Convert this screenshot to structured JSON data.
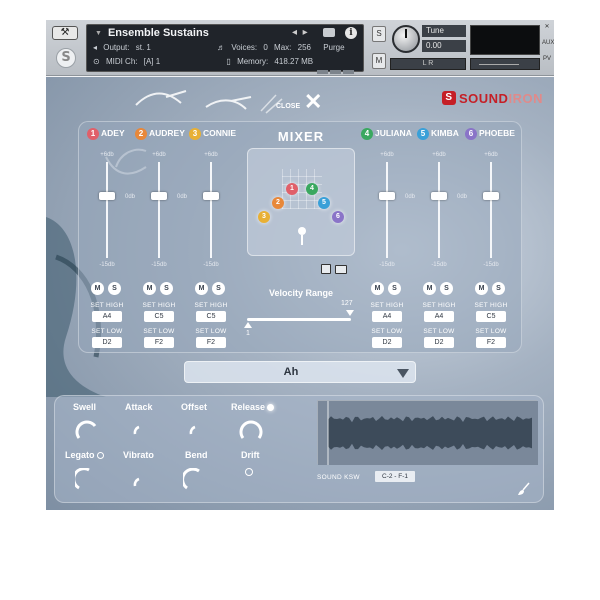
{
  "header": {
    "instrument_name": "Ensemble Sustains",
    "output_label": "Output:",
    "output_value": "st. 1",
    "voices_label": "Voices:",
    "voices_value": "0",
    "max_label": "Max:",
    "max_value": "256",
    "purge_label": "Purge",
    "midi_label": "MIDI Ch:",
    "midi_value": "[A]  1",
    "memory_label": "Memory:",
    "memory_value": "418.27 MB",
    "solo_label": "S",
    "mute_label": "M",
    "tune_label": "Tune",
    "tune_value": "0.00",
    "out_label": "L  R",
    "side_top": "AUX",
    "side_bottom": "PV"
  },
  "brand": {
    "s": "S",
    "name": "SOUND",
    "name2": "IRON"
  },
  "close": {
    "label": "CLOSE",
    "glyph": "✕"
  },
  "mixer": {
    "title": "MIXER",
    "singers": [
      {
        "num": "1",
        "name": "ADEY",
        "color": "#e0606a",
        "set_high": "A4",
        "set_low": "D2"
      },
      {
        "num": "2",
        "name": "AUDREY",
        "color": "#e8883a",
        "set_high": "C5",
        "set_low": "F2"
      },
      {
        "num": "3",
        "name": "CONNIE",
        "color": "#e8b035",
        "set_high": "C5",
        "set_low": "F2"
      },
      {
        "num": "4",
        "name": "JULIANA",
        "color": "#3aa860",
        "set_high": "A4",
        "set_low": "D2"
      },
      {
        "num": "5",
        "name": "KIMBA",
        "color": "#3aa0d8",
        "set_high": "A4",
        "set_low": "D2"
      },
      {
        "num": "6",
        "name": "PHOEBE",
        "color": "#8a74c8",
        "set_high": "C5",
        "set_low": "F2"
      }
    ],
    "fader_top": "+6db",
    "fader_mid": "0db",
    "fader_bot": "-15db",
    "mute": "M",
    "solo": "S",
    "set_high_label": "SET HIGH",
    "set_low_label": "SET LOW",
    "velocity_title": "Velocity Range",
    "velocity_min": "1",
    "velocity_max": "127"
  },
  "articulation": {
    "value": "Ah"
  },
  "controls": {
    "swell": "Swell",
    "attack": "Attack",
    "offset": "Offset",
    "release": "Release",
    "legato": "Legato",
    "vibrato": "Vibrato",
    "bend": "Bend",
    "drift": "Drift"
  },
  "keyswitch": {
    "label": "SOUND KSW",
    "value": "C-2 - F-1"
  }
}
